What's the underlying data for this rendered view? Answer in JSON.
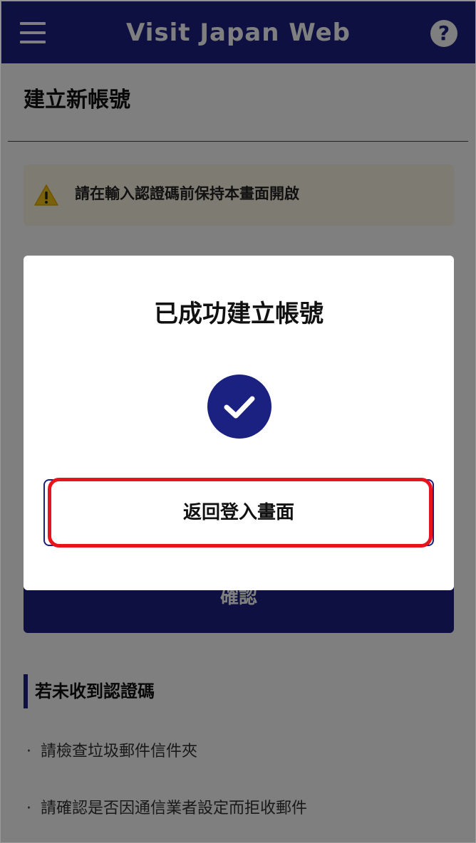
{
  "header": {
    "title": "Visit Japan Web",
    "menu_icon": "hamburger-menu-icon",
    "help_icon": "question-mark-icon",
    "help_glyph": "?",
    "background_color": "#1a2180"
  },
  "page": {
    "title": "建立新帳號",
    "warning": {
      "icon": "warning-triangle-icon",
      "text": "請在輸入認證碼前保持本畫面開啟"
    },
    "confirm_button_label": "確認",
    "no_code_section": {
      "heading": "若未收到認證碼",
      "items": [
        "請檢查垃圾郵件信件夾",
        "請確認是否因通信業者設定而拒收郵件"
      ]
    }
  },
  "modal": {
    "title": "已成功建立帳號",
    "icon": "checkmark-circle-icon",
    "button_label": "返回登入畫面",
    "highlight_color": "#e8141c"
  }
}
